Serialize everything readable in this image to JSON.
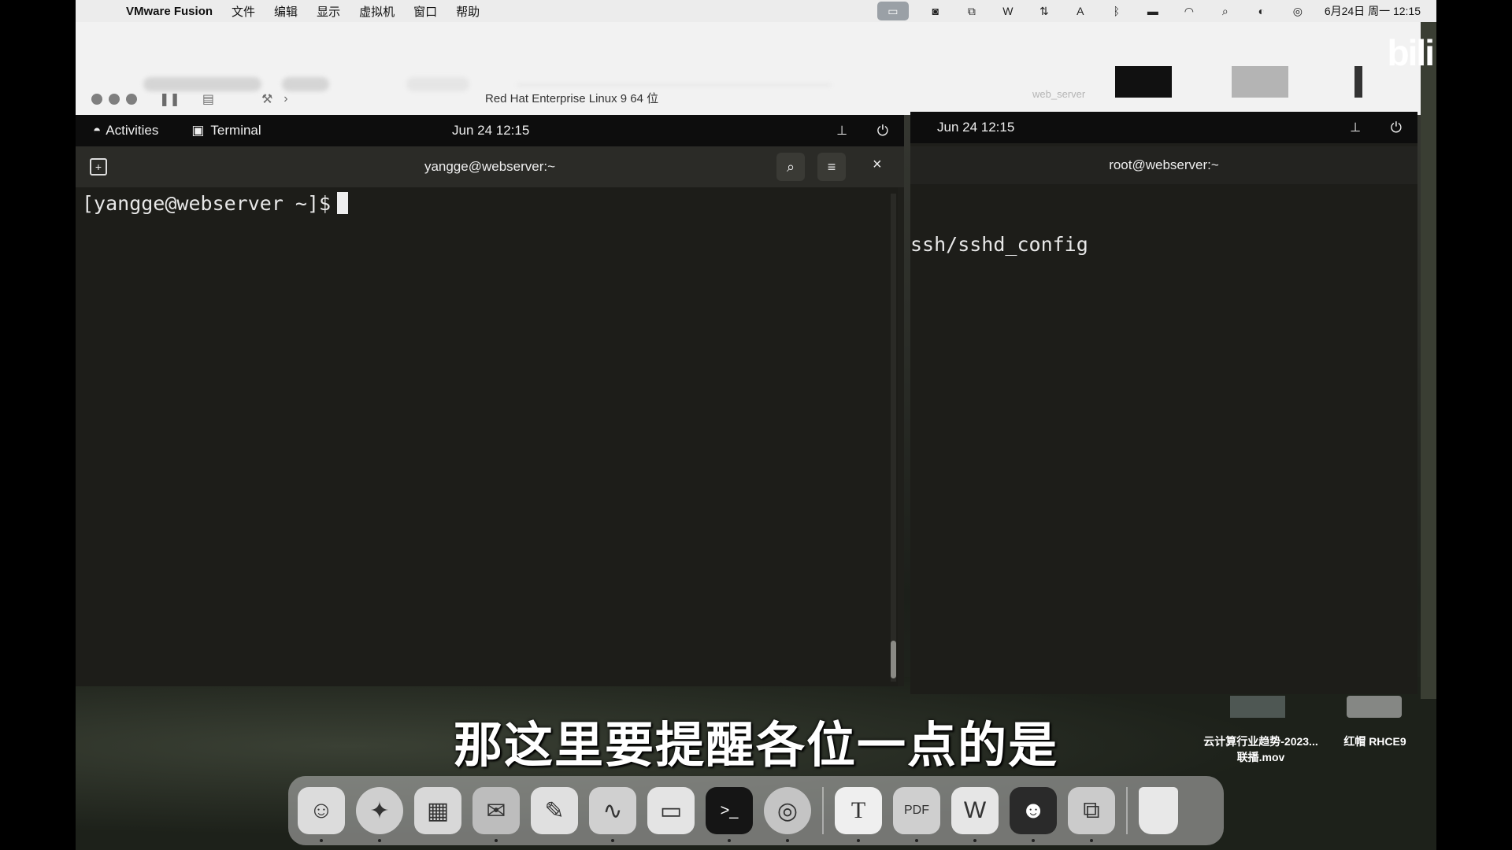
{
  "menubar": {
    "app_name": "VMware Fusion",
    "menus": [
      "文件",
      "编辑",
      "显示",
      "虚拟机",
      "窗口",
      "帮助"
    ],
    "datetime": "6月24日 周一  12:15"
  },
  "vmware": {
    "title": "Red Hat Enterprise Linux 9 64 位",
    "second_title": "web_server"
  },
  "watermark": "bili",
  "left_vm": {
    "activities": "Activities",
    "app_label": "Terminal",
    "clock": "Jun 24  12:15",
    "terminal_title": "yangge@webserver:~",
    "prompt": "[yangge@webserver ~]$"
  },
  "right_vm": {
    "clock": "Jun 24  12:15",
    "terminal_title": "root@webserver:~",
    "line": "ssh/sshd_config"
  },
  "desktop": {
    "item1": "云计算行业趋势-2023...联播.mov",
    "item2": "红帽 RHCE9"
  },
  "subtitle": "那这里要提醒各位一点的是",
  "dock": {
    "icons": [
      "finder-icon",
      "safari-icon",
      "launchpad-icon",
      "mail-icon",
      "pen-icon",
      "signature-icon",
      "folder-icon",
      "terminal-icon",
      "vpn-icon",
      "typora-icon",
      "pdf-icon",
      "wps-icon",
      "chat-icon",
      "vmware-icon",
      "trash-icon"
    ]
  }
}
